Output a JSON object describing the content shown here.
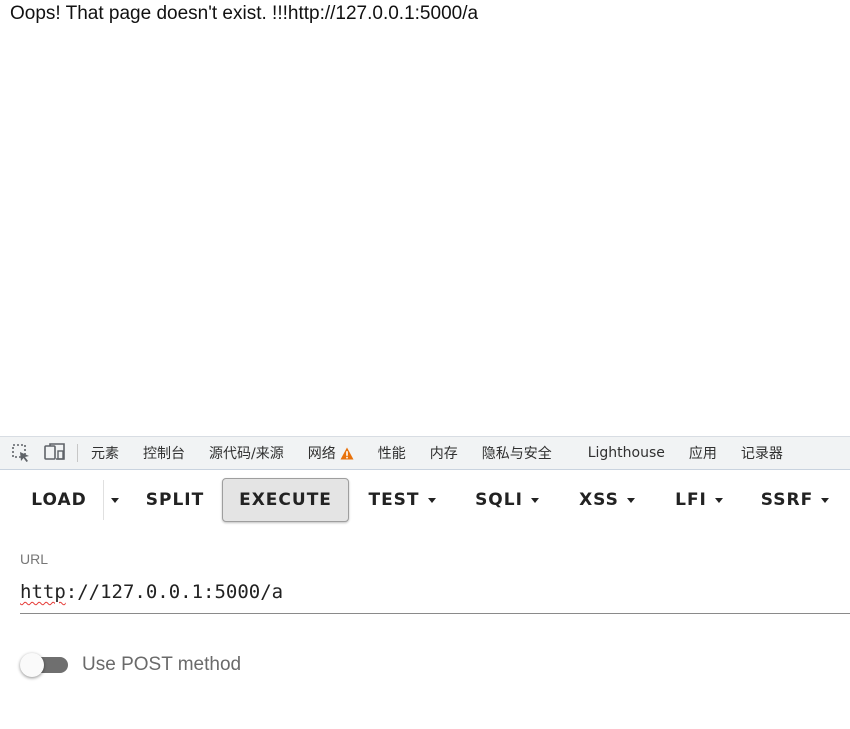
{
  "page": {
    "message": "Oops! That page doesn't exist. !!!http://127.0.0.1:5000/a"
  },
  "devtools": {
    "icons": [
      "element-picker-icon",
      "device-toolbar-icon"
    ],
    "tabs": [
      {
        "label": "元素"
      },
      {
        "label": "控制台"
      },
      {
        "label": "源代码/来源"
      },
      {
        "label": "网络",
        "warning": true
      },
      {
        "label": "性能"
      },
      {
        "label": "内存"
      },
      {
        "label": "隐私与安全"
      },
      {
        "label": "Lighthouse"
      },
      {
        "label": "应用"
      },
      {
        "label": "记录器"
      }
    ],
    "warning_color": "#e8710a"
  },
  "toolbar": {
    "load": "LOAD",
    "split": "SPLIT",
    "execute": "EXECUTE",
    "test": "TEST",
    "sqli": "SQLI",
    "xss": "XSS",
    "lfi": "LFI",
    "ssrf": "SSRF"
  },
  "url": {
    "label": "URL",
    "scheme": "http",
    "rest": "://127.0.0.1:5000/a"
  },
  "post_toggle": {
    "label": "Use POST method",
    "enabled": false
  }
}
